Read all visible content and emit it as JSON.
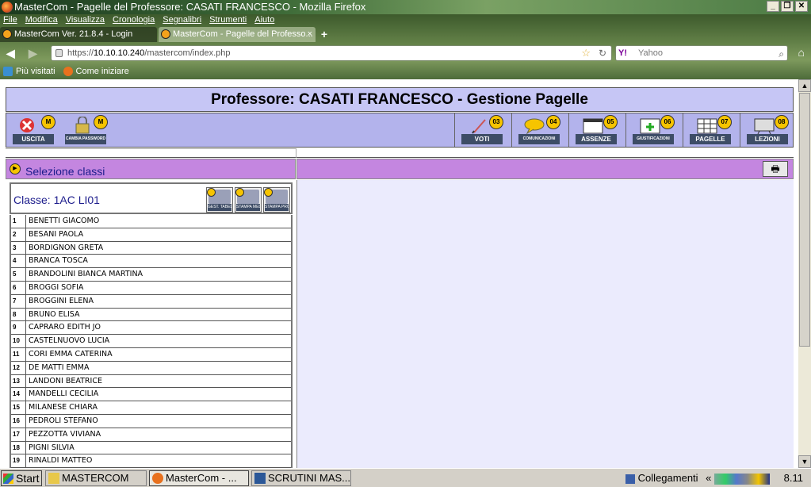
{
  "window": {
    "title": "MasterCom - Pagelle del Professore: CASATI FRANCESCO - Mozilla Firefox"
  },
  "menu": [
    "File",
    "Modifica",
    "Visualizza",
    "Cronologia",
    "Segnalibri",
    "Strumenti",
    "Aiuto"
  ],
  "tabs": [
    {
      "label": "MasterCom Ver. 21.8.4 - Login"
    },
    {
      "label": "MasterCom - Pagelle del Professo...",
      "close": "×"
    }
  ],
  "url": {
    "prefix": "https://",
    "host": "10.10.10.240",
    "path": "/mastercom/index.php"
  },
  "search": {
    "placeholder": "Yahoo",
    "logo": "Y!"
  },
  "bookmarks": [
    "Più visitati",
    "Come iniziare"
  ],
  "page": {
    "title": "Professore: CASATI FRANCESCO - Gestione Pagelle",
    "tools_left": [
      {
        "label": "USCITA",
        "badge": "M",
        "icon": "exit-icon"
      },
      {
        "label": "CAMBIA PASSWORD",
        "badge": "M",
        "icon": "lock-icon"
      }
    ],
    "tools_right": [
      {
        "label": "VOTI",
        "badge": "03",
        "icon": "pencil-icon"
      },
      {
        "label": "COMUNICAZIONI",
        "badge": "04",
        "icon": "speech-bubble-icon"
      },
      {
        "label": "ASSENZE",
        "badge": "05",
        "icon": "window-icon"
      },
      {
        "label": "GIUSTIFICAZIONI",
        "badge": "06",
        "icon": "plus-window-icon"
      },
      {
        "label": "PAGELLE",
        "badge": "07",
        "icon": "grid-icon"
      },
      {
        "label": "LEZIONI",
        "badge": "08",
        "icon": "board-icon"
      }
    ],
    "section_title": "Selezione classi",
    "class_label": "Classe: 1AC LI01",
    "class_buttons": [
      {
        "label": "GEST. TABELL.",
        "icon": "tools-icon"
      },
      {
        "label": "STAMPA MEDIE",
        "icon": "printer-icon"
      },
      {
        "label": "STAMPA PROSPETTO",
        "icon": "printer-icon"
      }
    ],
    "students": [
      {
        "n": "1",
        "name": "BENETTI GIACOMO"
      },
      {
        "n": "2",
        "name": "BESANI PAOLA"
      },
      {
        "n": "3",
        "name": "BORDIGNON GRETA"
      },
      {
        "n": "4",
        "name": "BRANCA TOSCA"
      },
      {
        "n": "5",
        "name": "BRANDOLINI BIANCA MARTINA"
      },
      {
        "n": "6",
        "name": "BROGGI SOFIA"
      },
      {
        "n": "7",
        "name": "BROGGINI ELENA"
      },
      {
        "n": "8",
        "name": "BRUNO ELISA"
      },
      {
        "n": "9",
        "name": "CAPRARO EDITH JO"
      },
      {
        "n": "10",
        "name": "CASTELNUOVO LUCIA"
      },
      {
        "n": "11",
        "name": "CORI EMMA CATERINA"
      },
      {
        "n": "12",
        "name": "DE MATTI EMMA"
      },
      {
        "n": "13",
        "name": "LANDONI BEATRICE"
      },
      {
        "n": "14",
        "name": "MANDELLI CECILIA"
      },
      {
        "n": "15",
        "name": "MILANESE CHIARA"
      },
      {
        "n": "16",
        "name": "PEDROLI STEFANO"
      },
      {
        "n": "17",
        "name": "PEZZOTTA VIVIANA"
      },
      {
        "n": "18",
        "name": "PIGNI SILVIA"
      },
      {
        "n": "19",
        "name": "RINALDI MATTEO"
      }
    ]
  },
  "taskbar": {
    "start": "Start",
    "items": [
      "MASTERCOM",
      "MasterCom - ...",
      "SCRUTINI MAS..."
    ],
    "links": "Collegamenti",
    "chevron": "«",
    "clock": "8.11"
  }
}
